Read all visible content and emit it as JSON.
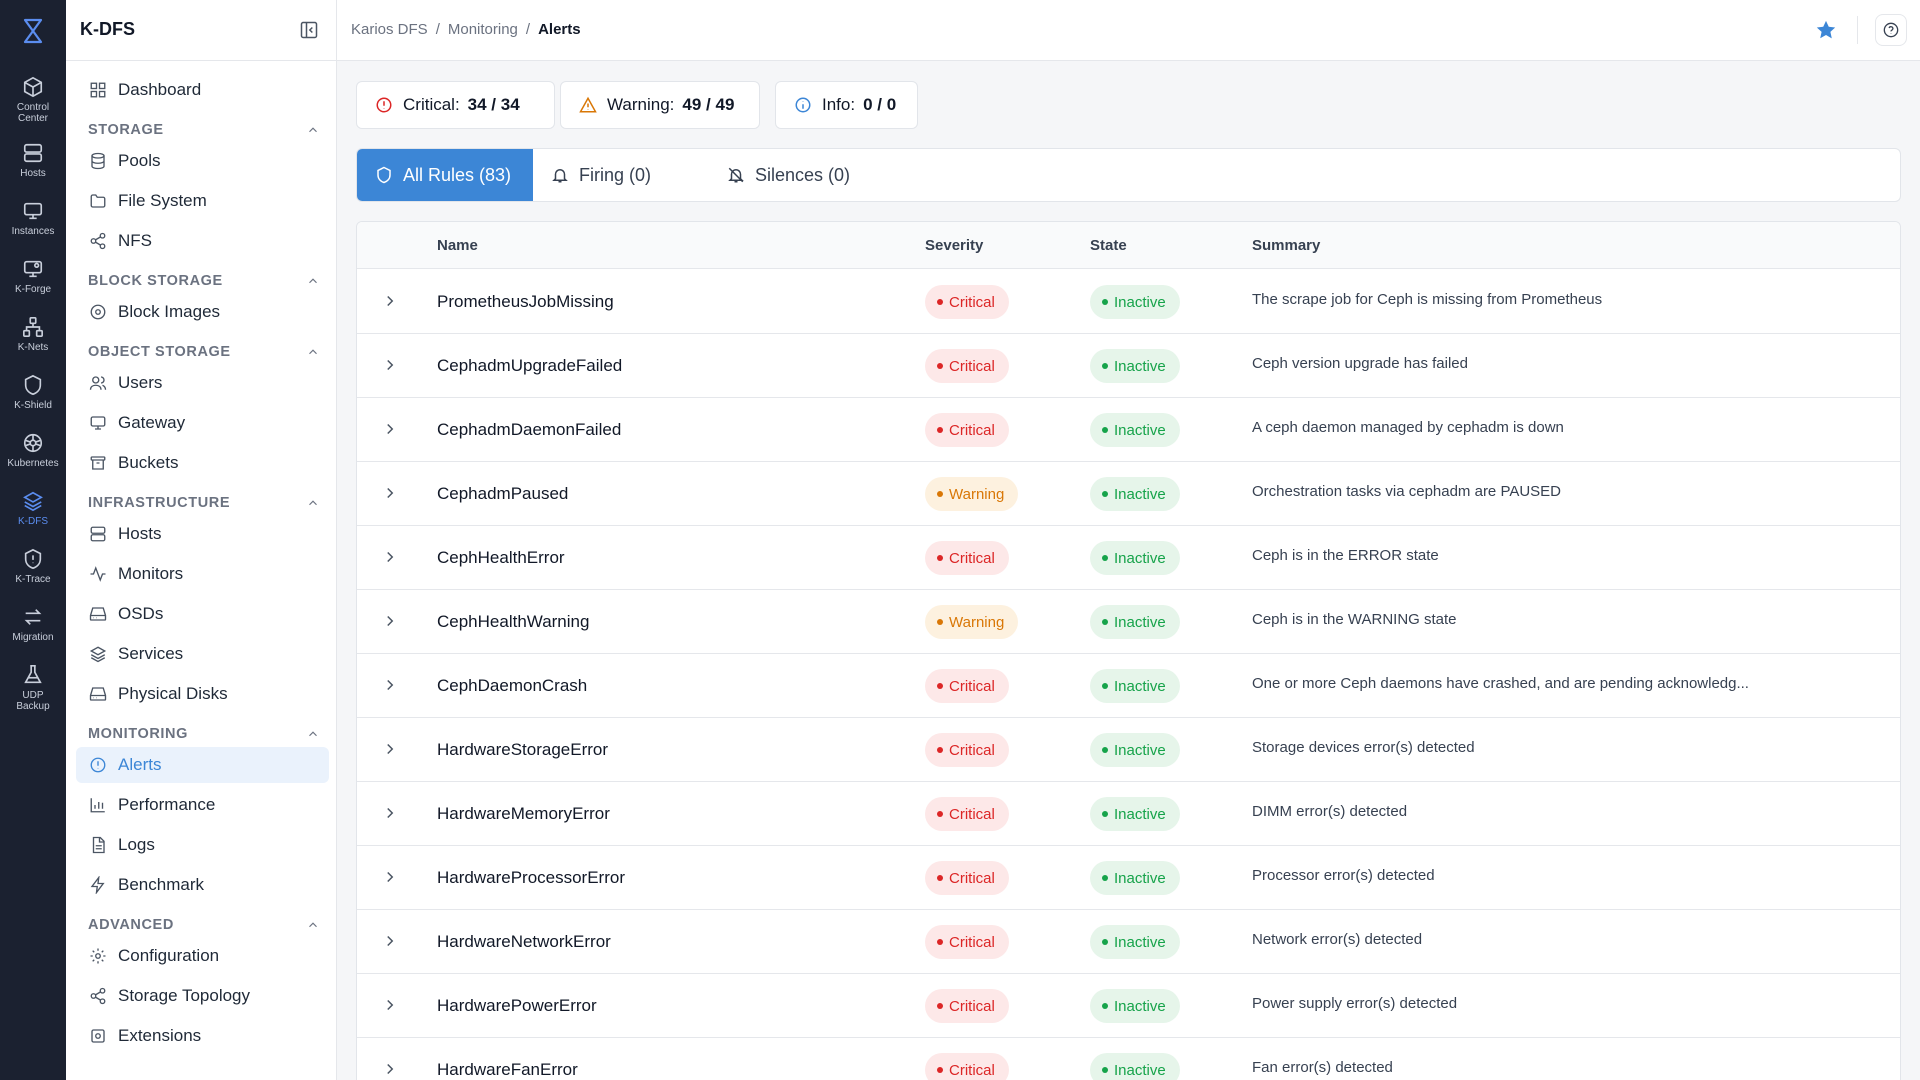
{
  "rail": {
    "items": [
      {
        "label": "Control\nCenter",
        "icon": "cube-icon"
      },
      {
        "label": "Hosts",
        "icon": "server-icon"
      },
      {
        "label": "Instances",
        "icon": "monitor-icon"
      },
      {
        "label": "K-Forge",
        "icon": "forge-icon"
      },
      {
        "label": "K-Nets",
        "icon": "network-icon"
      },
      {
        "label": "K-Shield",
        "icon": "shield-icon"
      },
      {
        "label": "Kubernetes",
        "icon": "kubernetes-icon"
      },
      {
        "label": "K-DFS",
        "icon": "layers-icon"
      },
      {
        "label": "K-Trace",
        "icon": "trace-icon"
      },
      {
        "label": "Migration",
        "icon": "arrows-icon"
      },
      {
        "label": "UDP\nBackup",
        "icon": "flask-icon"
      }
    ]
  },
  "sidebar": {
    "title": "K-DFS",
    "dashboard": "Dashboard",
    "sections": {
      "storage": "STORAGE",
      "block_storage": "BLOCK STORAGE",
      "object_storage": "OBJECT STORAGE",
      "infrastructure": "INFRASTRUCTURE",
      "monitoring": "MONITORING",
      "advanced": "ADVANCED"
    },
    "items": {
      "pools": "Pools",
      "file_system": "File System",
      "nfs": "NFS",
      "block_images": "Block Images",
      "users": "Users",
      "gateway": "Gateway",
      "buckets": "Buckets",
      "hosts": "Hosts",
      "monitors": "Monitors",
      "osds": "OSDs",
      "services": "Services",
      "physical_disks": "Physical Disks",
      "alerts": "Alerts",
      "performance": "Performance",
      "logs": "Logs",
      "benchmark": "Benchmark",
      "configuration": "Configuration",
      "storage_topology": "Storage Topology",
      "extensions": "Extensions"
    }
  },
  "breadcrumb": [
    "Karios DFS",
    "/",
    "Monitoring",
    "/",
    "Alerts"
  ],
  "summary": {
    "critical_label": "Critical:",
    "critical_count": "34 / 34",
    "warning_label": "Warning:",
    "warning_count": "49 / 49",
    "info_label": "Info:",
    "info_count": "0 / 0"
  },
  "tabs": {
    "all_rules": "All Rules (83)",
    "firing": "Firing (0)",
    "silences": "Silences (0)"
  },
  "table": {
    "headers": {
      "name": "Name",
      "severity": "Severity",
      "state": "State",
      "summary": "Summary"
    },
    "rows": [
      {
        "name": "PrometheusJobMissing",
        "severity": "Critical",
        "state": "Inactive",
        "summary": "The scrape job for Ceph is missing from Prometheus"
      },
      {
        "name": "CephadmUpgradeFailed",
        "severity": "Critical",
        "state": "Inactive",
        "summary": "Ceph version upgrade has failed"
      },
      {
        "name": "CephadmDaemonFailed",
        "severity": "Critical",
        "state": "Inactive",
        "summary": "A ceph daemon managed by cephadm is down"
      },
      {
        "name": "CephadmPaused",
        "severity": "Warning",
        "state": "Inactive",
        "summary": "Orchestration tasks via cephadm are PAUSED"
      },
      {
        "name": "CephHealthError",
        "severity": "Critical",
        "state": "Inactive",
        "summary": "Ceph is in the ERROR state"
      },
      {
        "name": "CephHealthWarning",
        "severity": "Warning",
        "state": "Inactive",
        "summary": "Ceph is in the WARNING state"
      },
      {
        "name": "CephDaemonCrash",
        "severity": "Critical",
        "state": "Inactive",
        "summary": "One or more Ceph daemons have crashed, and are pending acknowledg..."
      },
      {
        "name": "HardwareStorageError",
        "severity": "Critical",
        "state": "Inactive",
        "summary": "Storage devices error(s) detected"
      },
      {
        "name": "HardwareMemoryError",
        "severity": "Critical",
        "state": "Inactive",
        "summary": "DIMM error(s) detected"
      },
      {
        "name": "HardwareProcessorError",
        "severity": "Critical",
        "state": "Inactive",
        "summary": "Processor error(s) detected"
      },
      {
        "name": "HardwareNetworkError",
        "severity": "Critical",
        "state": "Inactive",
        "summary": "Network error(s) detected"
      },
      {
        "name": "HardwarePowerError",
        "severity": "Critical",
        "state": "Inactive",
        "summary": "Power supply error(s) detected"
      },
      {
        "name": "HardwareFanError",
        "severity": "Critical",
        "state": "Inactive",
        "summary": "Fan error(s) detected"
      }
    ]
  },
  "colors": {
    "accent": "#3c86d6",
    "critical": "#dc2626",
    "warning": "#d97706",
    "inactive": "#16a34a",
    "rail_bg": "#1b2130"
  }
}
